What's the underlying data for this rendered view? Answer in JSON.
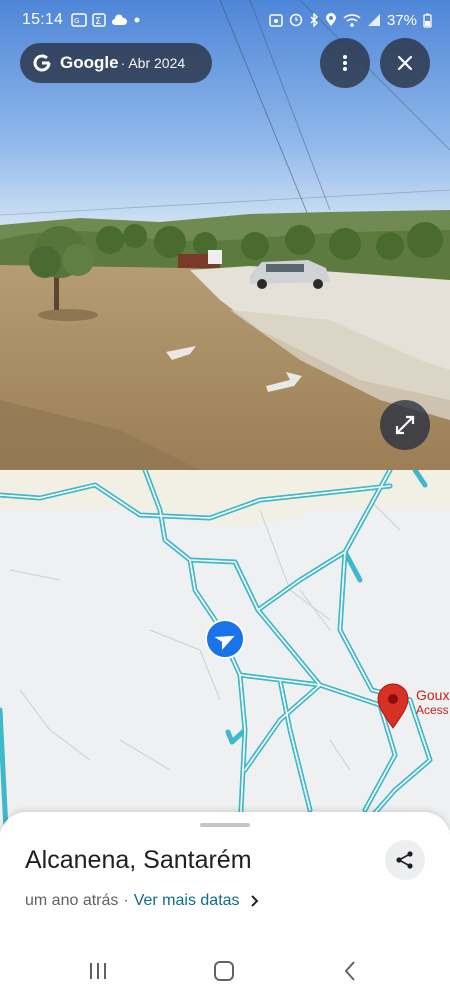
{
  "status_bar": {
    "time": "15:14",
    "battery": "37%",
    "icons_left": [
      "news-icon",
      "sigma-icon",
      "cloud-icon",
      "dot-icon"
    ],
    "icons_right": [
      "alarm-icon",
      "clock-icon",
      "bluetooth-icon",
      "location-icon",
      "wifi-icon",
      "signal-icon",
      "battery-icon"
    ]
  },
  "header": {
    "brand": "Google",
    "date": "· Abr 2024",
    "menu_icon": "more-vert-icon",
    "close_icon": "close-icon"
  },
  "streetview": {
    "expand_icon": "expand-icon"
  },
  "map": {
    "road_color": "#3fb8c9",
    "pin_color": "#d93025",
    "location_arrow_color": "#1a73e8",
    "place_label": "Goux",
    "place_sublabel": "Acess"
  },
  "sheet": {
    "title": "Alcanena, Santarém",
    "time_ago": "um ano atrás",
    "separator": "·",
    "more_dates": "Ver mais datas",
    "share_icon": "share-icon"
  },
  "nav": {
    "items": [
      "recents-icon",
      "home-icon",
      "back-icon"
    ]
  }
}
